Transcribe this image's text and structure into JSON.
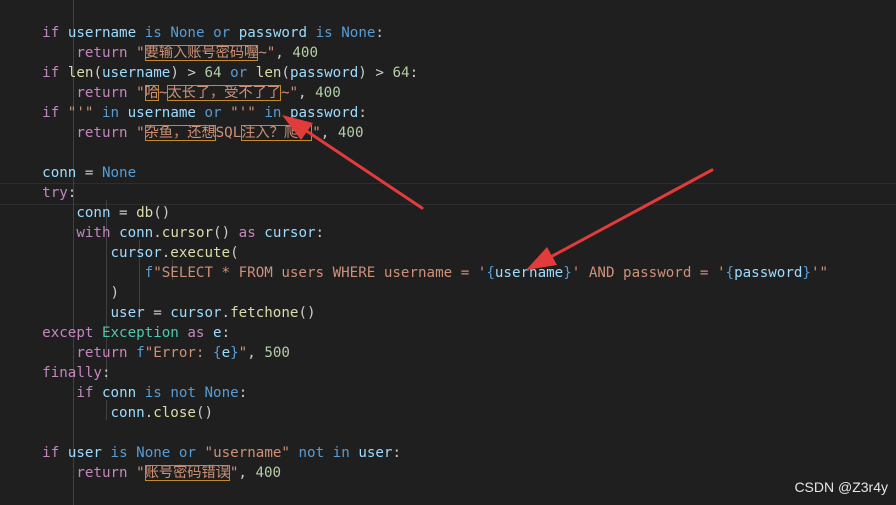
{
  "colors": {
    "background": "#1f1f1f",
    "keyword": "#569cd6",
    "control": "#c586c0",
    "variable": "#9cdcfe",
    "function": "#dcdcaa",
    "string": "#ce9178",
    "number": "#b5cea8",
    "class": "#4ec9b0",
    "plain": "#cccccc",
    "annotation_arrow": "#e23b3b",
    "highlight_box": "#c58a2b"
  },
  "code": {
    "lines": [
      {
        "tokens": [
          {
            "t": "    ",
            "c": "plain"
          },
          {
            "t": "if",
            "c": "control"
          },
          {
            "t": " ",
            "c": "plain"
          },
          {
            "t": "username",
            "c": "variable"
          },
          {
            "t": " ",
            "c": "plain"
          },
          {
            "t": "is",
            "c": "keyword"
          },
          {
            "t": " ",
            "c": "plain"
          },
          {
            "t": "None",
            "c": "keyword"
          },
          {
            "t": " ",
            "c": "plain"
          },
          {
            "t": "or",
            "c": "keyword"
          },
          {
            "t": " ",
            "c": "plain"
          },
          {
            "t": "password",
            "c": "variable"
          },
          {
            "t": " ",
            "c": "plain"
          },
          {
            "t": "is",
            "c": "keyword"
          },
          {
            "t": " ",
            "c": "plain"
          },
          {
            "t": "None",
            "c": "keyword"
          },
          {
            "t": ":",
            "c": "plain"
          }
        ]
      },
      {
        "tokens": [
          {
            "t": "        ",
            "c": "plain"
          },
          {
            "t": "return",
            "c": "control"
          },
          {
            "t": " \"",
            "c": "string"
          },
          {
            "t": "要输入账号密码喔",
            "c": "string",
            "box": true
          },
          {
            "t": "~\"",
            "c": "string"
          },
          {
            "t": ", ",
            "c": "plain"
          },
          {
            "t": "400",
            "c": "number"
          }
        ]
      },
      {
        "tokens": [
          {
            "t": "    ",
            "c": "plain"
          },
          {
            "t": "if",
            "c": "control"
          },
          {
            "t": " ",
            "c": "plain"
          },
          {
            "t": "len",
            "c": "function"
          },
          {
            "t": "(",
            "c": "plain"
          },
          {
            "t": "username",
            "c": "variable"
          },
          {
            "t": ") > ",
            "c": "plain"
          },
          {
            "t": "64",
            "c": "number"
          },
          {
            "t": " ",
            "c": "plain"
          },
          {
            "t": "or",
            "c": "keyword"
          },
          {
            "t": " ",
            "c": "plain"
          },
          {
            "t": "len",
            "c": "function"
          },
          {
            "t": "(",
            "c": "plain"
          },
          {
            "t": "password",
            "c": "variable"
          },
          {
            "t": ") > ",
            "c": "plain"
          },
          {
            "t": "64",
            "c": "number"
          },
          {
            "t": ":",
            "c": "plain"
          }
        ]
      },
      {
        "tokens": [
          {
            "t": "        ",
            "c": "plain"
          },
          {
            "t": "return",
            "c": "control"
          },
          {
            "t": " \"",
            "c": "string"
          },
          {
            "t": "哈",
            "c": "string",
            "box": true
          },
          {
            "t": "~",
            "c": "string"
          },
          {
            "t": "太长了，受不了了",
            "c": "string",
            "box": true
          },
          {
            "t": "~\"",
            "c": "string"
          },
          {
            "t": ", ",
            "c": "plain"
          },
          {
            "t": "400",
            "c": "number"
          }
        ]
      },
      {
        "tokens": [
          {
            "t": "    ",
            "c": "plain"
          },
          {
            "t": "if",
            "c": "control"
          },
          {
            "t": " \"'\" ",
            "c": "string"
          },
          {
            "t": "in",
            "c": "keyword"
          },
          {
            "t": " ",
            "c": "plain"
          },
          {
            "t": "username",
            "c": "variable"
          },
          {
            "t": " ",
            "c": "plain"
          },
          {
            "t": "or",
            "c": "keyword"
          },
          {
            "t": " \"'\" ",
            "c": "string"
          },
          {
            "t": "in",
            "c": "keyword"
          },
          {
            "t": " ",
            "c": "plain"
          },
          {
            "t": "password",
            "c": "variable"
          },
          {
            "t": ":",
            "c": "plain"
          }
        ]
      },
      {
        "tokens": [
          {
            "t": "        ",
            "c": "plain"
          },
          {
            "t": "return",
            "c": "control"
          },
          {
            "t": " \"",
            "c": "string"
          },
          {
            "t": "杂鱼，还想",
            "c": "string",
            "box": true
          },
          {
            "t": "SQL",
            "c": "string"
          },
          {
            "t": "注入？爬！",
            "c": "string",
            "box": true
          },
          {
            "t": "\"",
            "c": "string"
          },
          {
            "t": ", ",
            "c": "plain"
          },
          {
            "t": "400",
            "c": "number"
          }
        ]
      },
      {
        "tokens": []
      },
      {
        "tokens": [
          {
            "t": "    ",
            "c": "plain"
          },
          {
            "t": "conn",
            "c": "variable"
          },
          {
            "t": " = ",
            "c": "plain"
          },
          {
            "t": "None",
            "c": "keyword"
          }
        ]
      },
      {
        "tokens": [
          {
            "t": "    ",
            "c": "plain"
          },
          {
            "t": "try",
            "c": "control"
          },
          {
            "t": ":",
            "c": "plain"
          }
        ]
      },
      {
        "tokens": [
          {
            "t": "        ",
            "c": "plain"
          },
          {
            "t": "conn",
            "c": "variable"
          },
          {
            "t": " = ",
            "c": "plain"
          },
          {
            "t": "db",
            "c": "function"
          },
          {
            "t": "()",
            "c": "plain"
          }
        ]
      },
      {
        "tokens": [
          {
            "t": "        ",
            "c": "plain"
          },
          {
            "t": "with",
            "c": "control"
          },
          {
            "t": " ",
            "c": "plain"
          },
          {
            "t": "conn",
            "c": "variable"
          },
          {
            "t": ".",
            "c": "plain"
          },
          {
            "t": "cursor",
            "c": "function"
          },
          {
            "t": "() ",
            "c": "plain"
          },
          {
            "t": "as",
            "c": "control"
          },
          {
            "t": " ",
            "c": "plain"
          },
          {
            "t": "cursor",
            "c": "variable"
          },
          {
            "t": ":",
            "c": "plain"
          }
        ]
      },
      {
        "tokens": [
          {
            "t": "            ",
            "c": "plain"
          },
          {
            "t": "cursor",
            "c": "variable"
          },
          {
            "t": ".",
            "c": "plain"
          },
          {
            "t": "execute",
            "c": "function"
          },
          {
            "t": "(",
            "c": "plain"
          }
        ]
      },
      {
        "tokens": [
          {
            "t": "                ",
            "c": "plain"
          },
          {
            "t": "f",
            "c": "keyword"
          },
          {
            "t": "\"SELECT * FROM users WHERE username = '",
            "c": "string"
          },
          {
            "t": "{",
            "c": "keyword"
          },
          {
            "t": "username",
            "c": "variable"
          },
          {
            "t": "}",
            "c": "keyword"
          },
          {
            "t": "' AND password = '",
            "c": "string"
          },
          {
            "t": "{",
            "c": "keyword"
          },
          {
            "t": "password",
            "c": "variable"
          },
          {
            "t": "}",
            "c": "keyword"
          },
          {
            "t": "'\"",
            "c": "string"
          }
        ]
      },
      {
        "tokens": [
          {
            "t": "            ",
            "c": "plain"
          },
          {
            "t": ")",
            "c": "plain"
          }
        ]
      },
      {
        "tokens": [
          {
            "t": "            ",
            "c": "plain"
          },
          {
            "t": "user",
            "c": "variable"
          },
          {
            "t": " = ",
            "c": "plain"
          },
          {
            "t": "cursor",
            "c": "variable"
          },
          {
            "t": ".",
            "c": "plain"
          },
          {
            "t": "fetchone",
            "c": "function"
          },
          {
            "t": "()",
            "c": "plain"
          }
        ]
      },
      {
        "tokens": [
          {
            "t": "    ",
            "c": "plain"
          },
          {
            "t": "except",
            "c": "control"
          },
          {
            "t": " ",
            "c": "plain"
          },
          {
            "t": "Exception",
            "c": "class"
          },
          {
            "t": " ",
            "c": "plain"
          },
          {
            "t": "as",
            "c": "control"
          },
          {
            "t": " ",
            "c": "plain"
          },
          {
            "t": "e",
            "c": "variable"
          },
          {
            "t": ":",
            "c": "plain"
          }
        ]
      },
      {
        "tokens": [
          {
            "t": "        ",
            "c": "plain"
          },
          {
            "t": "return",
            "c": "control"
          },
          {
            "t": " ",
            "c": "plain"
          },
          {
            "t": "f",
            "c": "keyword"
          },
          {
            "t": "\"Error: ",
            "c": "string"
          },
          {
            "t": "{",
            "c": "keyword"
          },
          {
            "t": "e",
            "c": "variable"
          },
          {
            "t": "}",
            "c": "keyword"
          },
          {
            "t": "\"",
            "c": "string"
          },
          {
            "t": ", ",
            "c": "plain"
          },
          {
            "t": "500",
            "c": "number"
          }
        ]
      },
      {
        "tokens": [
          {
            "t": "    ",
            "c": "plain"
          },
          {
            "t": "finally",
            "c": "control"
          },
          {
            "t": ":",
            "c": "plain"
          }
        ]
      },
      {
        "tokens": [
          {
            "t": "        ",
            "c": "plain"
          },
          {
            "t": "if",
            "c": "control"
          },
          {
            "t": " ",
            "c": "plain"
          },
          {
            "t": "conn",
            "c": "variable"
          },
          {
            "t": " ",
            "c": "plain"
          },
          {
            "t": "is",
            "c": "keyword"
          },
          {
            "t": " ",
            "c": "plain"
          },
          {
            "t": "not",
            "c": "keyword"
          },
          {
            "t": " ",
            "c": "plain"
          },
          {
            "t": "None",
            "c": "keyword"
          },
          {
            "t": ":",
            "c": "plain"
          }
        ]
      },
      {
        "tokens": [
          {
            "t": "            ",
            "c": "plain"
          },
          {
            "t": "conn",
            "c": "variable"
          },
          {
            "t": ".",
            "c": "plain"
          },
          {
            "t": "close",
            "c": "function"
          },
          {
            "t": "()",
            "c": "plain"
          }
        ]
      },
      {
        "tokens": []
      },
      {
        "tokens": [
          {
            "t": "    ",
            "c": "plain"
          },
          {
            "t": "if",
            "c": "control"
          },
          {
            "t": " ",
            "c": "plain"
          },
          {
            "t": "user",
            "c": "variable"
          },
          {
            "t": " ",
            "c": "plain"
          },
          {
            "t": "is",
            "c": "keyword"
          },
          {
            "t": " ",
            "c": "plain"
          },
          {
            "t": "None",
            "c": "keyword"
          },
          {
            "t": " ",
            "c": "plain"
          },
          {
            "t": "or",
            "c": "keyword"
          },
          {
            "t": " ",
            "c": "plain"
          },
          {
            "t": "\"username\"",
            "c": "string"
          },
          {
            "t": " ",
            "c": "plain"
          },
          {
            "t": "not",
            "c": "keyword"
          },
          {
            "t": " ",
            "c": "plain"
          },
          {
            "t": "in",
            "c": "keyword"
          },
          {
            "t": " ",
            "c": "plain"
          },
          {
            "t": "user",
            "c": "variable"
          },
          {
            "t": ":",
            "c": "plain"
          }
        ]
      },
      {
        "tokens": [
          {
            "t": "        ",
            "c": "plain"
          },
          {
            "t": "return",
            "c": "control"
          },
          {
            "t": " \"",
            "c": "string"
          },
          {
            "t": "账号密码错误",
            "c": "string",
            "box": true
          },
          {
            "t": "\"",
            "c": "string"
          },
          {
            "t": ", ",
            "c": "plain"
          },
          {
            "t": "400",
            "c": "number"
          }
        ]
      }
    ]
  },
  "watermark": "CSDN @Z3r4y"
}
